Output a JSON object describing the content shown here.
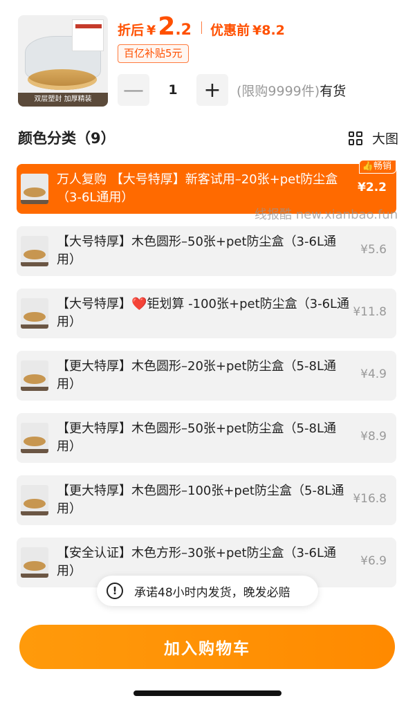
{
  "product": {
    "thumb_caption": "双层塑封  加厚精装",
    "price_label": "折后",
    "currency": "¥",
    "price_int": "2",
    "price_dec": ".2",
    "orig_label": "优惠前",
    "orig_price": "¥8.2",
    "subsidy": "百亿补贴5元",
    "accent_color": "#ff5000"
  },
  "quantity": {
    "minus": "—",
    "value": "1",
    "plus": "+",
    "limit": "(限购9999件)",
    "stock": "有货"
  },
  "section": {
    "title": "颜色分类（9）",
    "big_view": "大图"
  },
  "options": [
    {
      "text": "万人复购 【大号特厚】新客试用–20张+pet防尘盒（3-6L通用）",
      "price": "¥2.2",
      "badge": "畅销"
    },
    {
      "text": "【大号特厚】木色圆形–50张+pet防尘盒（3-6L通用）",
      "price": "¥5.6"
    },
    {
      "text_a": "【大号特厚】",
      "heart": "❤️",
      "text_b": "钜划算 -100张+pet防尘盒（3-6L通用）",
      "price": "¥11.8"
    },
    {
      "text": "【更大特厚】木色圆形–20张+pet防尘盒（5-8L通用）",
      "price": "¥4.9"
    },
    {
      "text": "【更大特厚】木色圆形–50张+pet防尘盒（5-8L通用）",
      "price": "¥8.9"
    },
    {
      "text": "【更大特厚】木色圆形–100张+pet防尘盒（5-8L通用）",
      "price": "¥16.8"
    },
    {
      "text": "【安全认证】木色方形–30张+pet防尘盒（3-6L通用）",
      "price": "¥6.9"
    }
  ],
  "watermark": "线报酷 new.xianbao.fun",
  "promise": {
    "icon": "!",
    "text": "承诺48小时内发货，晚发必赔"
  },
  "cart_button": "加入购物车"
}
